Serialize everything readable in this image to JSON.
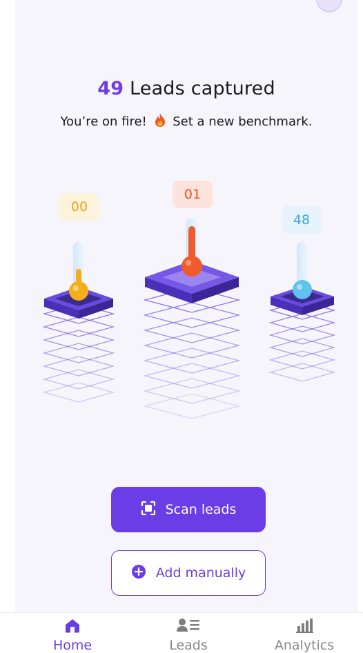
{
  "summary": {
    "count": "49",
    "headline_suffix": "Leads captured",
    "subtitle_prefix": "You’re on fire!",
    "subtitle_suffix": "Set a new benchmark."
  },
  "podiums": [
    {
      "value": "00",
      "badge_bg": "#fdf3dc",
      "badge_color": "#e9a60f",
      "bulb_color": "#f6ad1b",
      "level": 0.3
    },
    {
      "value": "01",
      "badge_bg": "#fde3dc",
      "badge_color": "#ea4e22",
      "bulb_color": "#f15a2c",
      "level": 0.95
    },
    {
      "value": "48",
      "badge_bg": "#e6f3fb",
      "badge_color": "#3ba8d8",
      "bulb_color": "#5fc2ef",
      "level": 0.1
    }
  ],
  "actions": {
    "scan_label": "Scan leads",
    "add_label": "Add manually"
  },
  "nav": {
    "items": [
      {
        "label": "Home",
        "icon": "home-icon"
      },
      {
        "label": "Leads",
        "icon": "leads-icon"
      },
      {
        "label": "Analytics",
        "icon": "analytics-icon"
      }
    ],
    "active_index": 0
  },
  "colors": {
    "accent": "#6b3de6",
    "podium_top": "#6a4bdf",
    "podium_side": "#4a2fb8"
  }
}
